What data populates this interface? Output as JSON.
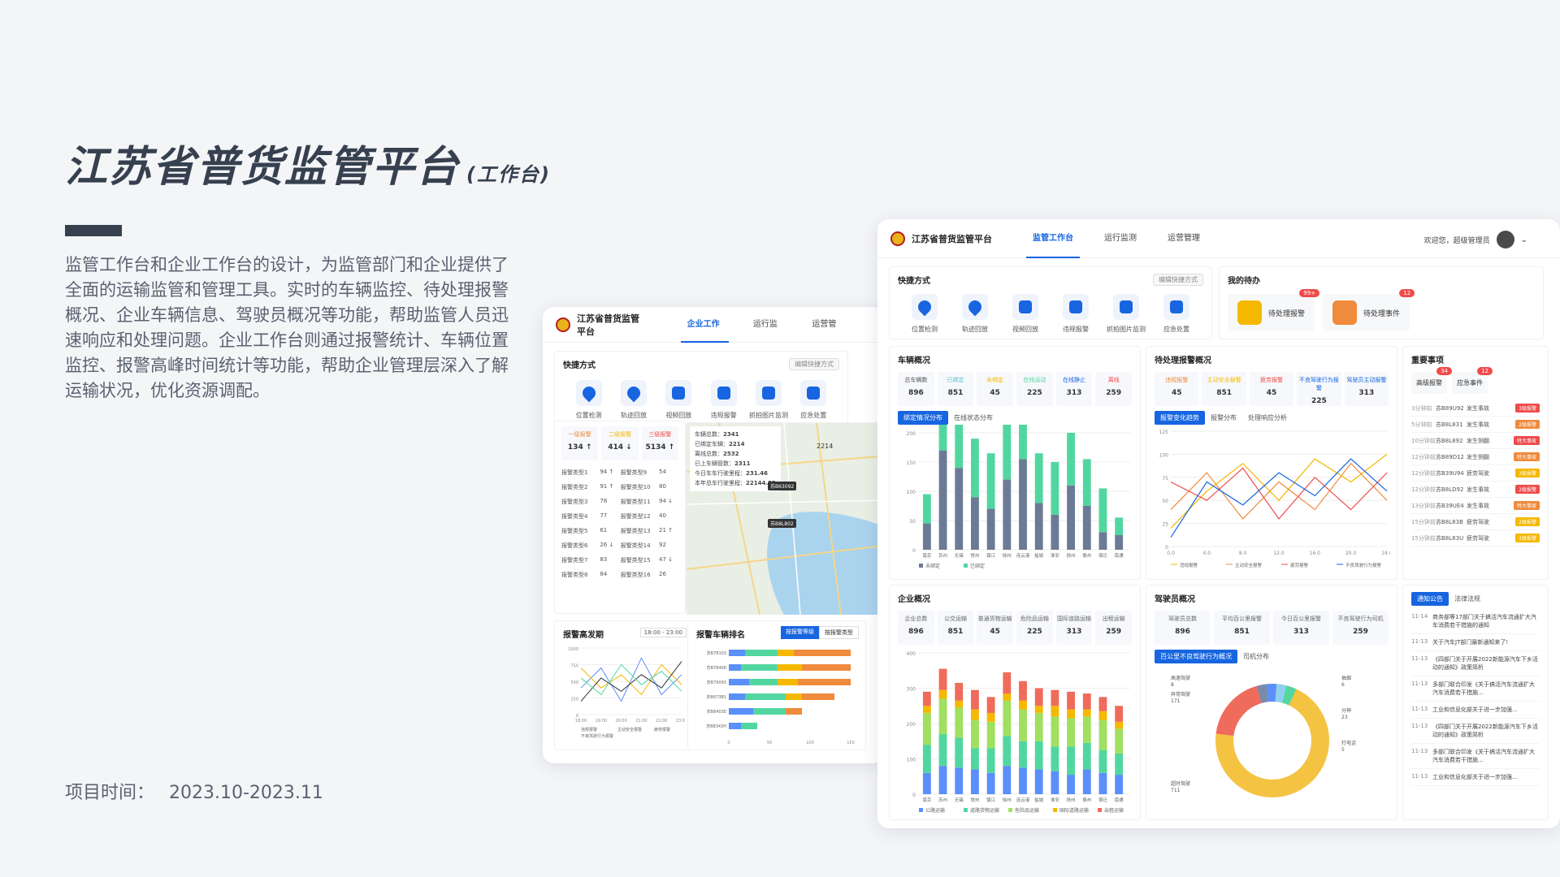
{
  "page": {
    "title": "江苏省普货监管平台",
    "title_sub": "(工作台)",
    "description": "监管工作台和企业工作台的设计，为监管部门和企业提供了全面的运输监管和管理工具。实时的车辆监控、待处理报警概况、企业车辆信息、驾驶员概况等功能，帮助监管人员迅速响应和处理问题。企业工作台则通过报警统计、车辆位置监控、报警高峰时间统计等功能，帮助企业管理层深入了解运输状况，优化资源调配。",
    "project_label": "项目时间：",
    "project_time": "2023.10-2023.11"
  },
  "colors": {
    "primary": "#1765e0",
    "green": "#52d6a0",
    "gray_blue": "#6c7a96",
    "title": "#36404f"
  },
  "small_app": {
    "brand": "江苏省普货监管平台",
    "tabs": [
      "企业工作台",
      "运行监测",
      "运营管理"
    ],
    "quick_title": "快捷方式",
    "edit_label": "编辑快捷方式",
    "quick": [
      {
        "label": "位置检测",
        "icon": "location-icon"
      },
      {
        "label": "轨迹回放",
        "icon": "track-icon"
      },
      {
        "label": "视频回放",
        "icon": "video-icon"
      },
      {
        "label": "违规报警",
        "icon": "alarm-icon"
      },
      {
        "label": "抓拍图片监测",
        "icon": "image-icon"
      },
      {
        "label": "应急处置",
        "icon": "emergency-icon"
      }
    ],
    "alarm_levels": [
      {
        "label": "一级报警",
        "value": "134 ↑",
        "color": "#f08a3c"
      },
      {
        "label": "二级报警",
        "value": "414 ↓",
        "color": "#f5b800"
      },
      {
        "label": "三级报警",
        "value": "5134 ↑",
        "color": "#ef4b4b"
      }
    ],
    "alarm_rows": [
      [
        "报警类型1",
        "94 ↑",
        "报警类型9",
        "54"
      ],
      [
        "报警类型2",
        "91 ↑",
        "报警类型10",
        "80"
      ],
      [
        "报警类型3",
        "78",
        "报警类型11",
        "94 ↓"
      ],
      [
        "报警类型4",
        "77",
        "报警类型12",
        "40"
      ],
      [
        "报警类型5",
        "61",
        "报警类型13",
        "21 ↑"
      ],
      [
        "报警类型6",
        "26 ↓",
        "报警类型14",
        "92"
      ],
      [
        "报警类型7",
        "83",
        "报警类型15",
        "47 ↓"
      ],
      [
        "报警类型8",
        "84",
        "报警类型16",
        "26"
      ]
    ],
    "map_stats": [
      {
        "label": "车辆总数：",
        "value": "2341"
      },
      {
        "label": "已绑定车辆：",
        "value": "2214"
      },
      {
        "label": "离线总数：",
        "value": "2532"
      },
      {
        "label": "已上车辆管数：",
        "value": "2311"
      },
      {
        "label": "今日车车行驶里程：",
        "value": "231.46"
      },
      {
        "label": "本年总车行驶里程：",
        "value": "22144.33"
      }
    ],
    "map_labels": [
      "2214",
      "苏B63092",
      "苏B8L802"
    ],
    "peak_title": "报警高发期",
    "peak_from": "18:00",
    "peak_sep": "-",
    "peak_to": "23:00",
    "rank_title": "报警车辆排名",
    "rank_tabs": [
      "按报警等级",
      "按报警类型"
    ],
    "rank_plates": [
      "苏B78103",
      "苏B7840K",
      "苏B79093",
      "苏B673B1",
      "苏B6403E",
      "苏B8343H"
    ],
    "rank_axis": [
      "0",
      "50",
      "100",
      "150"
    ],
    "peak_legend": [
      "违规报警",
      "主动安全报警",
      "疲劳报警",
      "不良驾驶行为报警"
    ],
    "peak_axis": [
      "18:00",
      "19:00",
      "20:00",
      "21:00",
      "22:00",
      "23:00"
    ],
    "peak_y": [
      "1000",
      "750",
      "500",
      "250",
      "0"
    ]
  },
  "big_app": {
    "brand": "江苏省普货监管平台",
    "tabs": [
      "监管工作台",
      "运行监测",
      "运营管理"
    ],
    "user": "欢迎您，超级管理员",
    "quick_title": "快捷方式",
    "edit_label": "编辑快捷方式",
    "quick": [
      {
        "label": "位置检测",
        "icon": "location-icon"
      },
      {
        "label": "轨迹回放",
        "icon": "track-icon"
      },
      {
        "label": "视频回放",
        "icon": "video-icon"
      },
      {
        "label": "违规报警",
        "icon": "alarm-icon"
      },
      {
        "label": "抓拍图片监测",
        "icon": "image-icon"
      },
      {
        "label": "应急处置",
        "icon": "emergency-icon"
      }
    ],
    "todo_title": "我的待办",
    "todo": [
      {
        "label": "待处理报警",
        "badge": "99+"
      },
      {
        "label": "待处理事件",
        "badge": "12"
      }
    ],
    "vehicle_title": "车辆概况",
    "vehicle_stats": [
      {
        "label": "总车辆数",
        "value": "896"
      },
      {
        "label": "已绑定",
        "value": "851"
      },
      {
        "label": "未绑定",
        "value": "45"
      },
      {
        "label": "在线运动",
        "value": "225"
      },
      {
        "label": "在线静止",
        "value": "313"
      },
      {
        "label": "离线",
        "value": "259"
      }
    ],
    "vehicle_tabs": [
      "绑定情况分布",
      "在线状态分布"
    ],
    "vehicle_legend": [
      "未绑定",
      "已绑定"
    ],
    "alarm_title": "待处理报警概况",
    "alarm_stats": [
      {
        "label": "违规报警",
        "value": "45"
      },
      {
        "label": "主动安全报警",
        "value": "851"
      },
      {
        "label": "疲劳报警",
        "value": "45"
      },
      {
        "label": "不良驾驶行为报警",
        "value": "225"
      },
      {
        "label": "驾驶员主动报警",
        "value": "313"
      }
    ],
    "alarm_tabs": [
      "报警变化趋势",
      "报警分布",
      "处理响应分析"
    ],
    "alarm_legend": [
      "违规报警",
      "主动安全报警",
      "疲劳报警",
      "不良驾驶行为报警",
      "驾驶员主动报警"
    ],
    "important_title": "重要事项",
    "important_boxes": [
      {
        "label": "高级报警",
        "badge": "34"
      },
      {
        "label": "应急事件",
        "badge": "12"
      }
    ],
    "important_list": [
      [
        "3分钟前",
        "苏B89U92",
        "发生事故",
        "3级报警",
        "#ef4b4b"
      ],
      [
        "5分钟前",
        "苏B8L831",
        "发生事故",
        "2级报警",
        "#f08a3c"
      ],
      [
        "10分钟前",
        "苏B8L892",
        "发生侧翻",
        "特大事故",
        "#ef4b4b"
      ],
      [
        "12分钟前",
        "苏B89D12",
        "发生侧翻",
        "特大事故",
        "#f08a3c"
      ],
      [
        "12分钟前",
        "苏B39U94",
        "疲劳驾驶",
        "3级报警",
        "#f5b800"
      ],
      [
        "12分钟前",
        "苏B8LD92",
        "发生事故",
        "2级报警",
        "#ef4b4b"
      ],
      [
        "13分钟前",
        "苏B39UE4",
        "发生事故",
        "特大事故",
        "#f08a3c"
      ],
      [
        "15分钟前",
        "苏B8L83B",
        "疲劳驾驶",
        "2级报警",
        "#f5b800"
      ],
      [
        "15分钟前",
        "苏B8L83U",
        "疲劳驾驶",
        "3级报警",
        "#f5b800"
      ]
    ],
    "company_title": "企业概况",
    "company_stats": [
      {
        "label": "企业总数",
        "value": "896"
      },
      {
        "label": "公交运输",
        "value": "851"
      },
      {
        "label": "普通货物运输",
        "value": "45"
      },
      {
        "label": "危险品运输",
        "value": "225"
      },
      {
        "label": "国际道路运输",
        "value": "313"
      },
      {
        "label": "出租运输",
        "value": "259"
      }
    ],
    "company_legend": [
      "公路运输",
      "道路货物运输",
      "危险品运输",
      "国际道路运输",
      "出租运输"
    ],
    "driver_title": "驾驶员概况",
    "driver_stats": [
      {
        "label": "驾驶员总数",
        "value": "896"
      },
      {
        "label": "平均百公里报警",
        "value": "851"
      },
      {
        "label": "今日百公里报警",
        "value": "313"
      },
      {
        "label": "不良驾驶行为司机",
        "value": "259"
      }
    ],
    "driver_tabs": [
      "百公里不良驾驶行为概况",
      "司机分布"
    ],
    "donut_labels": [
      {
        "text": "高速驾驶",
        "value": "8"
      },
      {
        "text": "抽烟",
        "value": "6"
      },
      {
        "text": "打电话",
        "value": "5"
      },
      {
        "text": "超时驾驶",
        "value": "711"
      },
      {
        "text": "异常驾驶",
        "value": "171"
      },
      {
        "text": "分神",
        "value": "23"
      }
    ],
    "notice_tabs": [
      "通知公告",
      "法律法规"
    ],
    "notices": [
      [
        "11-14",
        "商务部等17部门关于搞活汽车流通扩大汽车消费若干措施的通知"
      ],
      [
        "11-13",
        "关于汽车JT部门最新通知来了!"
      ],
      [
        "11-13",
        "《四部门关于开展2022新能源汽车下乡活动的通知》政策简析"
      ],
      [
        "11-13",
        "多部门联合印发《关于搞活汽车流通扩大汽车消费若干措施..."
      ],
      [
        "11-13",
        "工业和信息化部关于进一步加强..."
      ],
      [
        "11-13",
        "《四部门关于开展2022新能源汽车下乡活动的通知》政策简析"
      ],
      [
        "11-13",
        "多部门联合印发《关于搞活汽车流通扩大汽车消费若干措施..."
      ],
      [
        "11-13",
        "工业和信息化部关于进一步加强..."
      ]
    ]
  },
  "chart_data": [
    {
      "type": "bar",
      "title": "车辆概况",
      "categories": [
        "南京",
        "苏州",
        "无锡",
        "常州",
        "镇江",
        "徐州",
        "连云港",
        "盐城",
        "淮安",
        "扬州",
        "泰州",
        "宿迁",
        "南通"
      ],
      "ylim": [
        0,
        200
      ],
      "series": [
        {
          "name": "未绑定",
          "values": [
            45,
            170,
            140,
            90,
            70,
            120,
            155,
            80,
            60,
            110,
            75,
            30,
            25
          ]
        },
        {
          "name": "已绑定",
          "values": [
            50,
            100,
            115,
            100,
            95,
            110,
            95,
            85,
            90,
            90,
            80,
            75,
            30
          ]
        }
      ]
    },
    {
      "type": "bar",
      "title": "企业概况",
      "categories": [
        "南京",
        "苏州",
        "无锡",
        "常州",
        "镇江",
        "徐州",
        "连云港",
        "盐城",
        "淮安",
        "扬州",
        "泰州",
        "宿迁",
        "南通"
      ],
      "ylim": [
        0,
        400
      ],
      "series": [
        {
          "name": "公路运输",
          "values": [
            60,
            80,
            75,
            70,
            60,
            80,
            75,
            70,
            65,
            55,
            70,
            60,
            55
          ]
        },
        {
          "name": "道路货物运输",
          "values": [
            80,
            90,
            85,
            60,
            70,
            85,
            75,
            80,
            70,
            80,
            75,
            65,
            60
          ]
        },
        {
          "name": "危险品运输",
          "values": [
            90,
            100,
            85,
            80,
            75,
            100,
            90,
            80,
            85,
            80,
            75,
            85,
            70
          ]
        },
        {
          "name": "国际道路运输",
          "values": [
            20,
            25,
            20,
            30,
            25,
            20,
            25,
            20,
            30,
            25,
            20,
            25,
            20
          ]
        },
        {
          "name": "出租运输",
          "values": [
            40,
            60,
            50,
            55,
            45,
            60,
            55,
            50,
            45,
            50,
            45,
            40,
            45
          ]
        }
      ]
    },
    {
      "type": "line",
      "title": "报警变化趋势",
      "x": [
        "0.0",
        "4.0",
        "8.0",
        "12.0",
        "16.0",
        "20.0",
        "24.0"
      ],
      "ylim": [
        0,
        125
      ],
      "series": [
        {
          "name": "违规报警",
          "values": [
            20,
            60,
            90,
            50,
            95,
            70,
            100
          ]
        },
        {
          "name": "主动安全报警",
          "values": [
            40,
            80,
            30,
            70,
            40,
            90,
            50
          ]
        },
        {
          "name": "疲劳报警",
          "values": [
            70,
            50,
            85,
            30,
            75,
            40,
            80
          ]
        },
        {
          "name": "不良驾驶行为报警",
          "values": [
            10,
            70,
            45,
            80,
            55,
            95,
            60
          ]
        }
      ]
    },
    {
      "type": "pie",
      "title": "百公里不良驾驶行为概况",
      "categories": [
        "超时驾驶",
        "异常驾驶",
        "分神",
        "高速驾驶",
        "抽烟",
        "打电话"
      ],
      "values": [
        711,
        171,
        23,
        8,
        6,
        5
      ]
    }
  ]
}
